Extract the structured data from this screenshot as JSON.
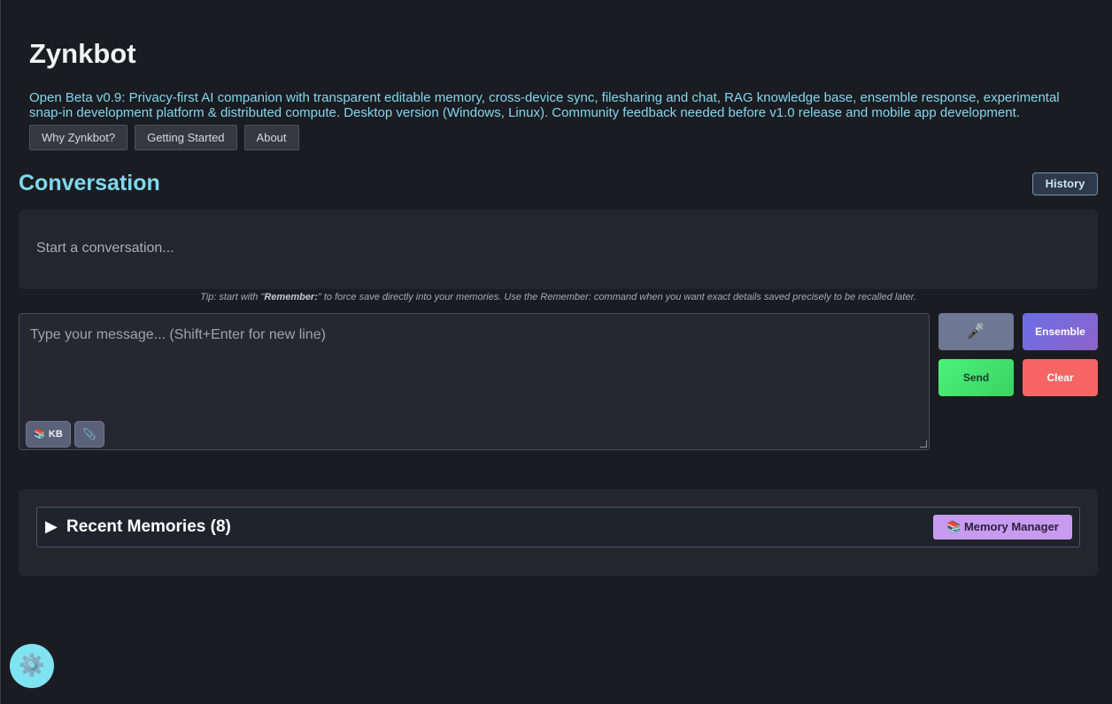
{
  "app": {
    "title": "Zynkbot",
    "subtitle": "Open Beta v0.9: Privacy-first AI companion with transparent editable memory, cross-device sync, filesharing and chat, RAG knowledge base, ensemble response, experimental snap-in development platform & distributed compute. Desktop version (Windows, Linux). Community feedback needed before v1.0 release and mobile app development."
  },
  "nav": {
    "items": [
      "Why Zynkbot?",
      "Getting Started",
      "About"
    ]
  },
  "conversation": {
    "title": "Conversation",
    "history_label": "History",
    "placeholder": "Start a conversation..."
  },
  "tip": {
    "prefix": "Tip: start with \"",
    "keyword": "Remember:",
    "suffix": "\" to force save directly into your memories. Use the Remember: command when you want exact details saved precisely to be recalled later."
  },
  "composer": {
    "placeholder": "Type your message... (Shift+Enter for new line)",
    "kb_label": "📚 KB",
    "attach_icon": "📎"
  },
  "actions": {
    "mic_icon": "🎤",
    "ensemble_label": "Ensemble",
    "send_label": "Send",
    "clear_label": "Clear"
  },
  "memories": {
    "toggle_icon": "▶",
    "title": "Recent Memories (8)",
    "manager_label": "📚 Memory Manager"
  },
  "settings": {
    "icon": "⚙️"
  },
  "colors": {
    "accent": "#7fd8ee",
    "background": "#1b1c21",
    "send": "#39d463",
    "clear": "#f76464",
    "ensemble": "#7b6ad9",
    "memory_manager": "#c79bf0"
  }
}
